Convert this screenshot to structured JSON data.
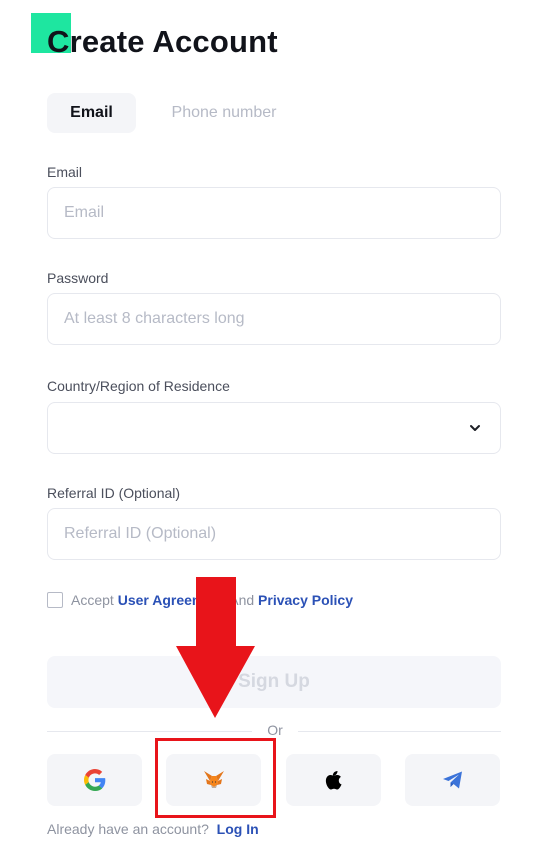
{
  "page": {
    "title": "Create Account"
  },
  "tabs": [
    {
      "label": "Email",
      "active": true
    },
    {
      "label": "Phone number",
      "active": false
    }
  ],
  "form": {
    "email": {
      "label": "Email",
      "placeholder": "Email",
      "value": ""
    },
    "password": {
      "label": "Password",
      "placeholder": "At least 8 characters long",
      "value": ""
    },
    "country": {
      "label": "Country/Region of Residence",
      "value": ""
    },
    "referral": {
      "label": "Referral ID (Optional)",
      "placeholder": "Referral ID (Optional)",
      "value": ""
    }
  },
  "terms": {
    "accept": "Accept",
    "user_agreement": "User Agreement",
    "and": "And",
    "privacy_policy": "Privacy Policy",
    "checked": false
  },
  "signup": {
    "label": "Sign Up",
    "enabled": false
  },
  "divider": {
    "label": "Or"
  },
  "social": [
    {
      "icon": "google-icon"
    },
    {
      "icon": "metamask-fox-icon"
    },
    {
      "icon": "apple-icon"
    },
    {
      "icon": "telegram-icon"
    }
  ],
  "login": {
    "prompt": "Already have an account?",
    "link": "Log In"
  },
  "colors": {
    "accent": "#1ee6a0",
    "link": "#2b51b6",
    "annotation": "#e8141a"
  }
}
